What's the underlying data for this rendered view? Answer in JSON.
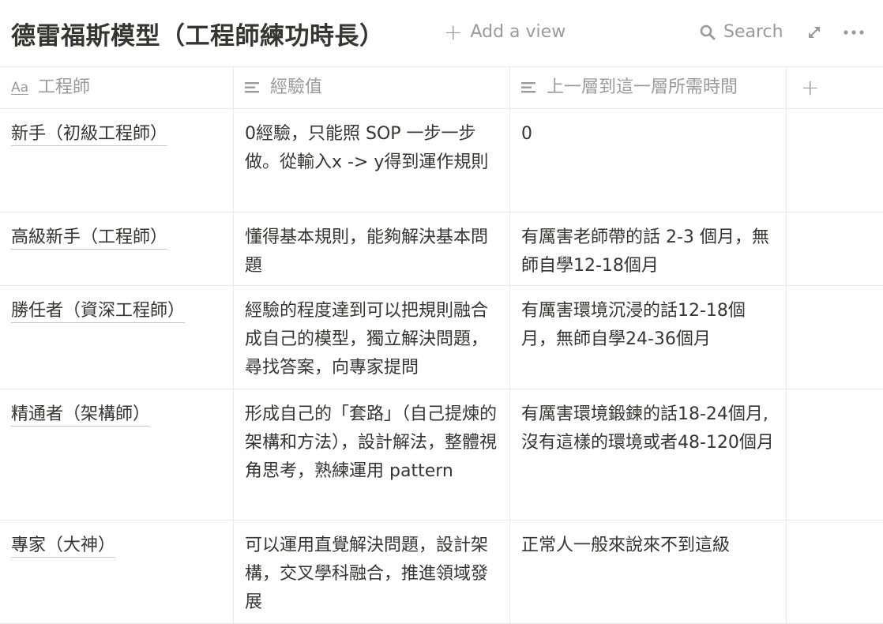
{
  "header": {
    "title": "德雷福斯模型（工程師練功時長）",
    "add_view": "Add a view",
    "search": "Search"
  },
  "columns": [
    {
      "label": "工程師",
      "icon": "title-aa-icon"
    },
    {
      "label": "經驗值",
      "icon": "text-lines-icon"
    },
    {
      "label": "上一層到這一層所需時間",
      "icon": "text-lines-icon"
    },
    {
      "label": "+"
    }
  ],
  "rows": [
    {
      "name": "新手（初級工程師）",
      "exp": "0經驗，只能照 SOP 一步一步做。從輸入x -> y得到運作規則",
      "time": "0"
    },
    {
      "name": "高級新手（工程師）",
      "exp": "懂得基本規則，能夠解決基本問題",
      "time": "有厲害老師帶的話 2-3 個月，無師自學12-18個月"
    },
    {
      "name": "勝任者（資深工程師）",
      "exp": "經驗的程度達到可以把規則融合成自己的模型，獨立解決問題，尋找答案，向專家提問",
      "time": "有厲害環境沉浸的話12-18個月，無師自學24-36個月"
    },
    {
      "name": "精通者（架構師）",
      "exp": "形成自己的「套路」（自己提煉的架構和方法），設計解法，整體視角思考，熟練運用 pattern",
      "time": "有厲害環境鍛鍊的話18-24個月, 沒有這樣的環境或者48-120個月"
    },
    {
      "name": "專家（大神）",
      "exp": "可以運用直覺解決問題，設計架構，交叉學科融合，推進領域發展",
      "time": "正常人一般來說來不到這級"
    }
  ]
}
